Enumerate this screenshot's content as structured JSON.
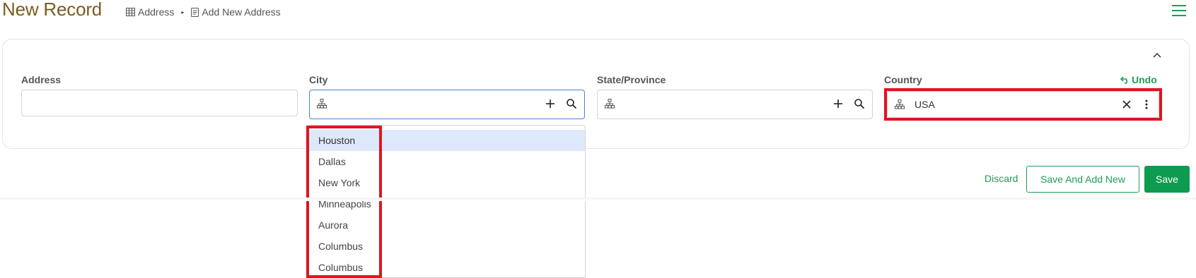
{
  "header": {
    "title": "New Record",
    "breadcrumb": [
      {
        "label": "Address",
        "icon": "table-icon"
      },
      {
        "label": "Add New Address",
        "icon": "form-icon"
      }
    ],
    "menu_icon": "hamburger-menu-icon"
  },
  "form": {
    "fields": [
      {
        "label": "Address",
        "value": ""
      },
      {
        "label": "City",
        "value": ""
      },
      {
        "label": "State/Province",
        "value": ""
      },
      {
        "label": "Country",
        "value": "USA"
      }
    ],
    "undo_label": "Undo"
  },
  "city_dropdown": {
    "options": [
      "Houston",
      "Dallas",
      "New York",
      "Minneapolis",
      "Aurora",
      "Columbus",
      "Columbus"
    ],
    "highlighted_index": 0
  },
  "actions": {
    "discard": "Discard",
    "save_and_add_new": "Save And Add New",
    "save": "Save"
  },
  "colors": {
    "title": "#7a5c1e",
    "accent_green": "#1e9e55",
    "highlight_red": "#e0141e",
    "focus_blue": "#4a7fd6",
    "dropdown_active": "#dde9fb"
  }
}
